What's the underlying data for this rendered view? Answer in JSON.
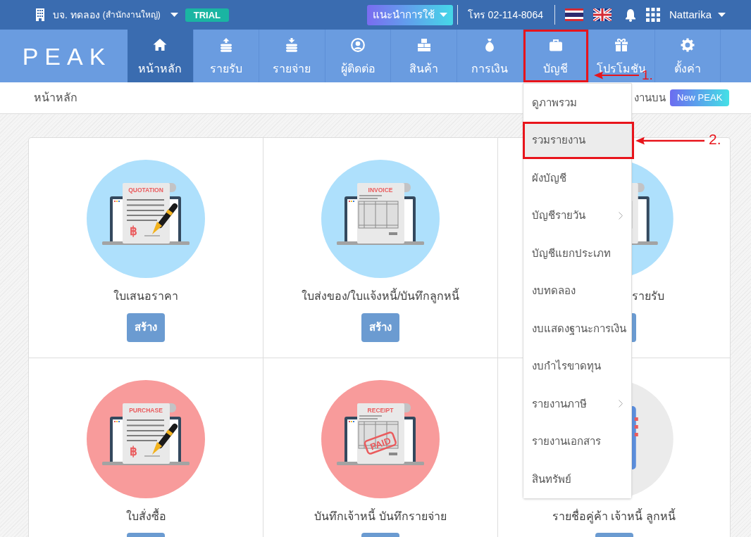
{
  "top_bar": {
    "company_name": "บจ. ทดลอง",
    "branch": "(สำนักงานใหญ่)",
    "plan_badge": "TRIAL",
    "guide_button": "แนะนำการใช้",
    "phone": "โทร 02-114-8064",
    "user_name": "Nattarika"
  },
  "nav": {
    "logo": "PEAK",
    "items": [
      {
        "label": "หน้าหลัก",
        "selected": true,
        "annotated": false
      },
      {
        "label": "รายรับ",
        "selected": false,
        "annotated": false
      },
      {
        "label": "รายจ่าย",
        "selected": false,
        "annotated": false
      },
      {
        "label": "ผู้ติดต่อ",
        "selected": false,
        "annotated": false
      },
      {
        "label": "สินค้า",
        "selected": false,
        "annotated": false
      },
      {
        "label": "การเงิน",
        "selected": false,
        "annotated": false
      },
      {
        "label": "บัญชี",
        "selected": false,
        "annotated": true
      },
      {
        "label": "โปรโมชัน",
        "selected": false,
        "annotated": false
      },
      {
        "label": "ตั้งค่า",
        "selected": false,
        "annotated": false
      }
    ]
  },
  "page_header": {
    "title": "หน้าหลัก",
    "notice_text": "งานบน",
    "notice_badge": "New PEAK"
  },
  "cards": [
    {
      "kind": "signed",
      "color": "#aee0fc",
      "doc_title": "QUOTATION",
      "currency": "฿",
      "label": "ใบเสนอราคา",
      "label_clipped": false,
      "art_clipped": false,
      "button": {
        "kind": "full",
        "label": "สร้าง"
      }
    },
    {
      "kind": "table",
      "color": "#aee0fc",
      "doc_title": "INVOICE",
      "label": "ใบส่งของ/ใบแจ้งหนี้/บันทึกลูกหนี้",
      "label_clipped": false,
      "art_clipped": false,
      "button": {
        "kind": "full",
        "label": "สร้าง"
      }
    },
    {
      "kind": "table",
      "color": "#aee0fc",
      "label": "รายรับ",
      "label_clipped": true,
      "art_clipped": true,
      "button": {
        "kind": "sliver"
      }
    },
    {
      "kind": "signed",
      "color": "#f89b9b",
      "doc_title": "PURCHASE",
      "currency": "฿",
      "label": "ใบสั่งซื้อ",
      "label_clipped": false,
      "art_clipped": false,
      "button": {
        "kind": "edge"
      }
    },
    {
      "kind": "table",
      "color": "#f89b9b",
      "doc_title": "RECEIPT",
      "stamp": "PAID",
      "label": "บันทึกเจ้าหนี้ บันทึกรายจ่าย",
      "label_clipped": false,
      "art_clipped": false,
      "button": {
        "kind": "edge"
      }
    },
    {
      "kind": "address-book",
      "color": "#ebebeb",
      "label": "รายชื่อคู่ค้า เจ้าหนี้ ลูกหนี้",
      "label_clipped": false,
      "art_clipped": true,
      "button": {
        "kind": "edge"
      }
    }
  ],
  "dropdown_menu": {
    "items": [
      {
        "label": "ดูภาพรวม",
        "has_submenu": false,
        "selected": false,
        "annotated": false
      },
      {
        "label": "รวมรายงาน",
        "has_submenu": false,
        "selected": true,
        "annotated": true
      },
      {
        "label": "ผังบัญชี",
        "has_submenu": false,
        "selected": false,
        "annotated": false
      },
      {
        "label": "บัญชีรายวัน",
        "has_submenu": true,
        "selected": false,
        "annotated": false
      },
      {
        "label": "บัญชีแยกประเภท",
        "has_submenu": false,
        "selected": false,
        "annotated": false
      },
      {
        "label": "งบทดลอง",
        "has_submenu": false,
        "selected": false,
        "annotated": false
      },
      {
        "label": "งบแสดงฐานะการเงิน",
        "has_submenu": false,
        "selected": false,
        "annotated": false
      },
      {
        "label": "งบกำไรขาดทุน",
        "has_submenu": false,
        "selected": false,
        "annotated": false
      },
      {
        "label": "รายงานภาษี",
        "has_submenu": true,
        "selected": false,
        "annotated": false
      },
      {
        "label": "รายงานเอกสาร",
        "has_submenu": false,
        "selected": false,
        "annotated": false
      },
      {
        "label": "สินทรัพย์",
        "has_submenu": false,
        "selected": false,
        "annotated": false
      }
    ]
  },
  "annotations": [
    {
      "label": "1."
    },
    {
      "label": "2."
    }
  ]
}
